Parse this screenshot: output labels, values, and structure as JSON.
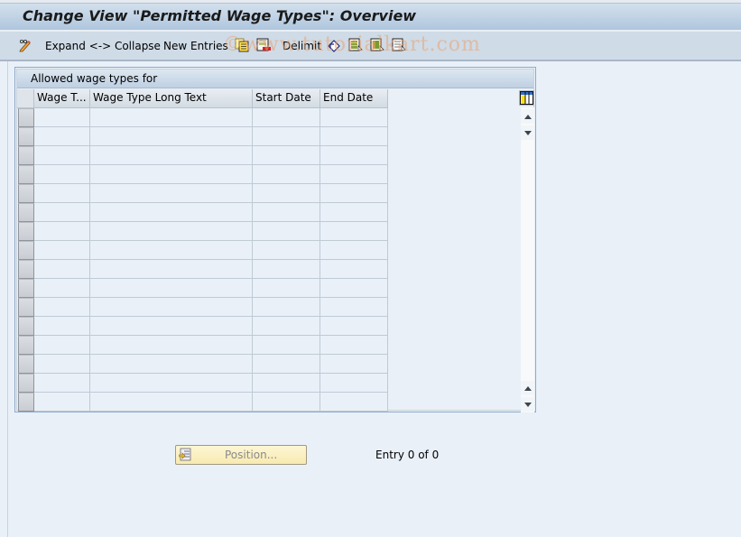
{
  "window": {
    "title": "Change View \"Permitted Wage Types\": Overview"
  },
  "toolbar": {
    "items": [
      {
        "type": "icon",
        "icon": "display-change-icon"
      },
      {
        "type": "button",
        "label": "Expand <-> Collapse"
      },
      {
        "type": "button",
        "label": "New Entries"
      },
      {
        "type": "icon",
        "icon": "copy-as-icon"
      },
      {
        "type": "icon",
        "icon": "delete-icon"
      },
      {
        "type": "button",
        "label": "Delimit"
      },
      {
        "type": "icon",
        "icon": "undo-change-icon"
      },
      {
        "type": "icon",
        "icon": "select-all-icon"
      },
      {
        "type": "icon",
        "icon": "select-block-icon"
      },
      {
        "type": "icon",
        "icon": "deselect-all-icon"
      }
    ],
    "expand_collapse_label": "Expand <-> Collapse",
    "new_entries_label": "New Entries",
    "delimit_label": "Delimit"
  },
  "watermark": "©www.tutorialkart.com",
  "table": {
    "title": "Allowed wage types for",
    "columns": [
      {
        "key": "wage_type",
        "label": "Wage T..."
      },
      {
        "key": "long_text",
        "label": "Wage Type Long Text"
      },
      {
        "key": "start_date",
        "label": "Start Date"
      },
      {
        "key": "end_date",
        "label": "End Date"
      }
    ],
    "rows": [
      {
        "wage_type": "",
        "long_text": "",
        "start_date": "",
        "end_date": ""
      },
      {
        "wage_type": "",
        "long_text": "",
        "start_date": "",
        "end_date": ""
      },
      {
        "wage_type": "",
        "long_text": "",
        "start_date": "",
        "end_date": ""
      },
      {
        "wage_type": "",
        "long_text": "",
        "start_date": "",
        "end_date": ""
      },
      {
        "wage_type": "",
        "long_text": "",
        "start_date": "",
        "end_date": ""
      },
      {
        "wage_type": "",
        "long_text": "",
        "start_date": "",
        "end_date": ""
      },
      {
        "wage_type": "",
        "long_text": "",
        "start_date": "",
        "end_date": ""
      },
      {
        "wage_type": "",
        "long_text": "",
        "start_date": "",
        "end_date": ""
      },
      {
        "wage_type": "",
        "long_text": "",
        "start_date": "",
        "end_date": ""
      },
      {
        "wage_type": "",
        "long_text": "",
        "start_date": "",
        "end_date": ""
      },
      {
        "wage_type": "",
        "long_text": "",
        "start_date": "",
        "end_date": ""
      },
      {
        "wage_type": "",
        "long_text": "",
        "start_date": "",
        "end_date": ""
      },
      {
        "wage_type": "",
        "long_text": "",
        "start_date": "",
        "end_date": ""
      },
      {
        "wage_type": "",
        "long_text": "",
        "start_date": "",
        "end_date": ""
      },
      {
        "wage_type": "",
        "long_text": "",
        "start_date": "",
        "end_date": ""
      },
      {
        "wage_type": "",
        "long_text": "",
        "start_date": "",
        "end_date": ""
      }
    ]
  },
  "footer": {
    "position_button_label": "Position...",
    "entry_text": "Entry 0 of 0"
  },
  "colors": {
    "background": "#e9f0f8",
    "title_bar": "#afc6dd",
    "toolbar": "#cfdbe6",
    "position_button": "#f8eab0"
  }
}
